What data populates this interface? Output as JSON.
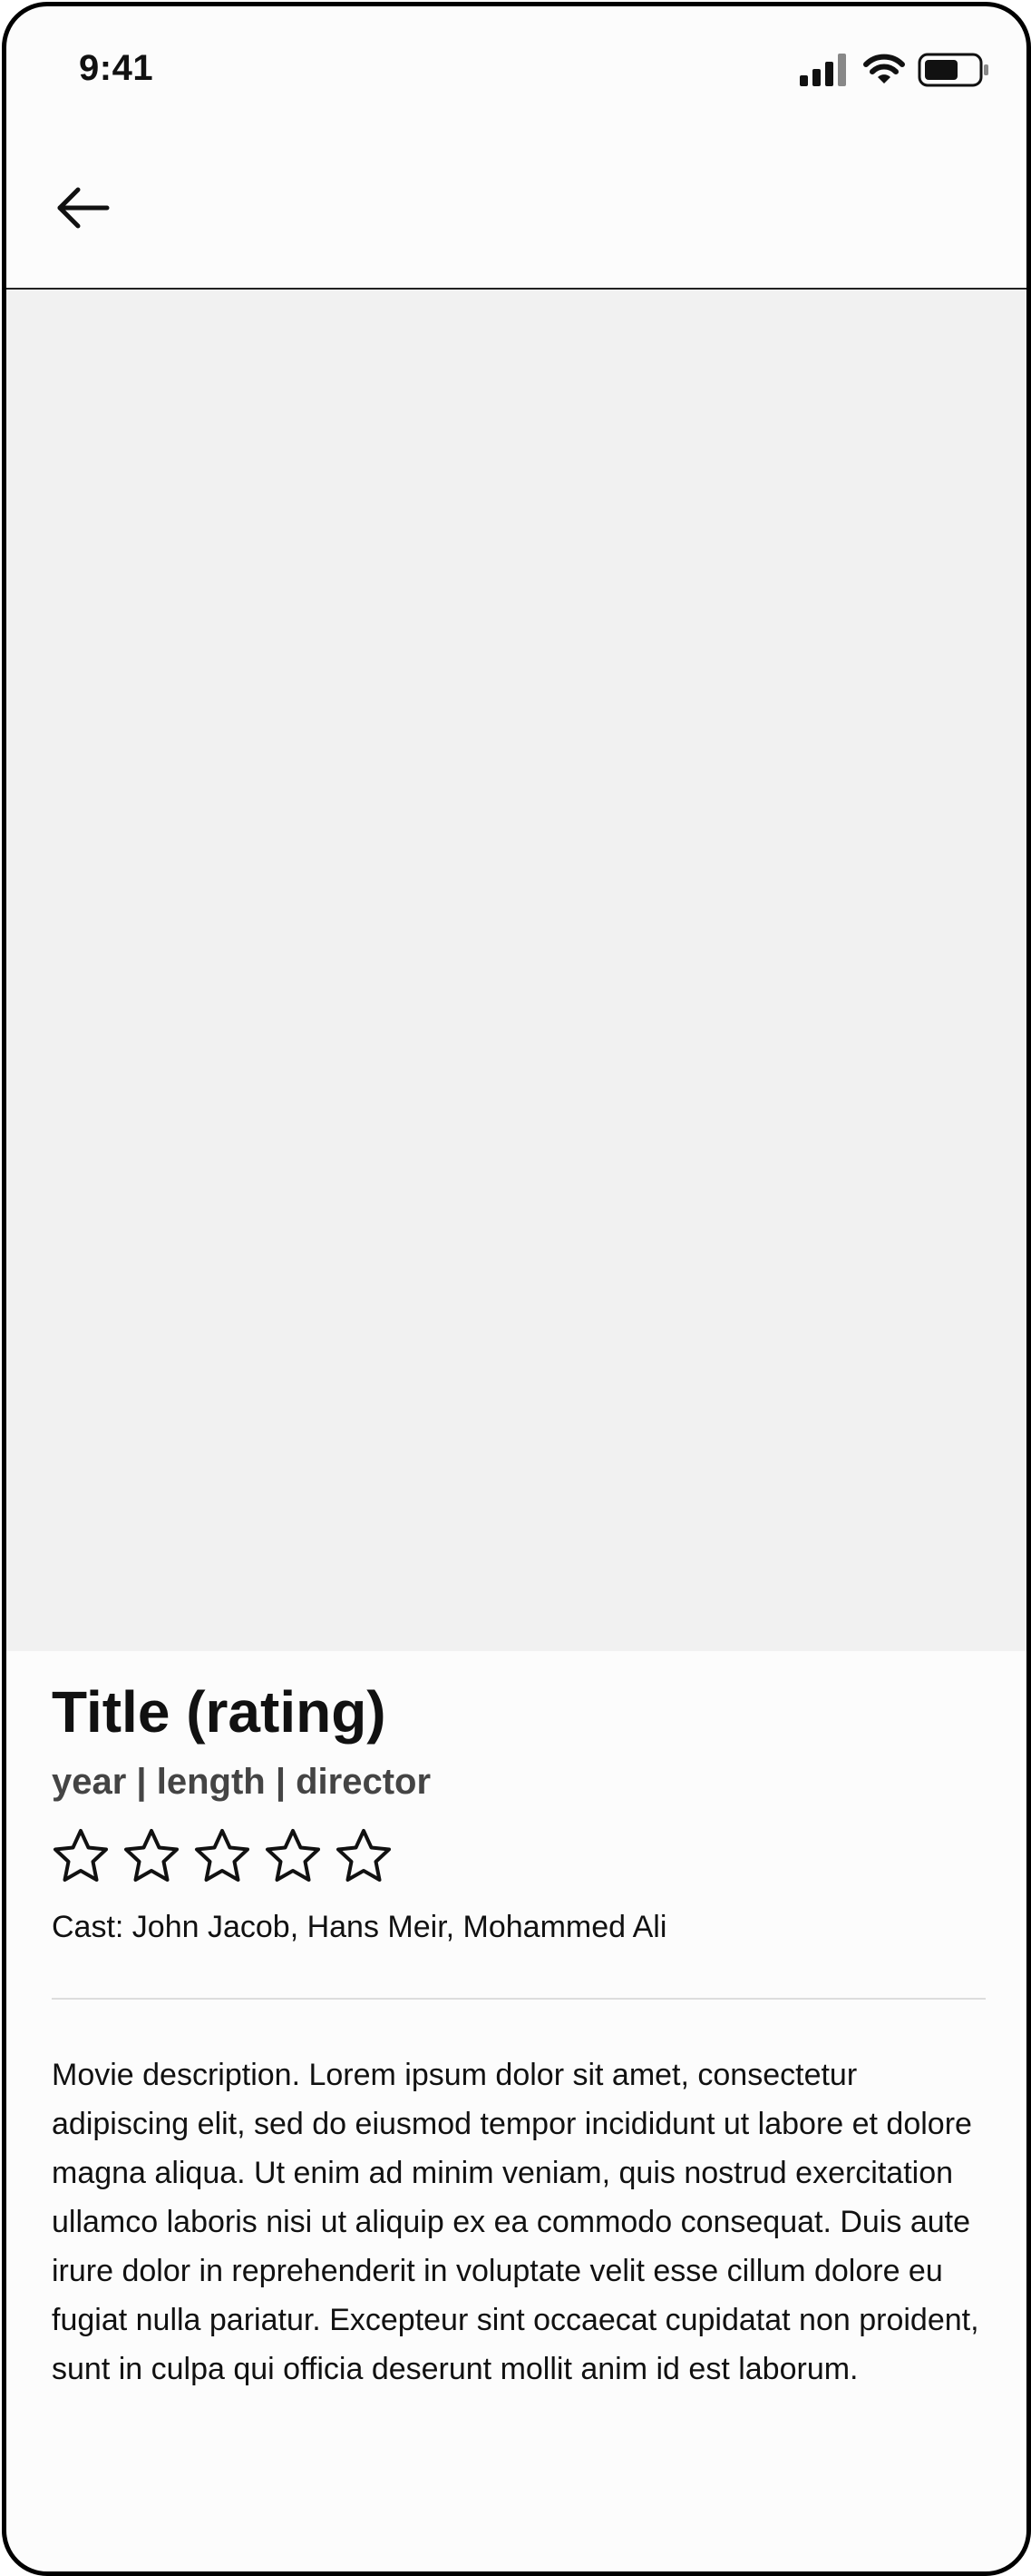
{
  "status_bar": {
    "time": "9:41"
  },
  "icons": {
    "back": "back-arrow-icon",
    "signal": "cellular-signal-icon",
    "wifi": "wifi-icon",
    "battery": "battery-icon",
    "star": "star-outline-icon"
  },
  "movie": {
    "title": "Title (rating)",
    "meta": "year | length | director",
    "rating_stars_filled": 0,
    "rating_stars_total": 5,
    "cast": "Cast: John Jacob, Hans Meir, Mohammed Ali",
    "description": "Movie description. Lorem ipsum dolor sit amet, consectetur adipiscing elit, sed do eiusmod tempor incididunt ut labore et dolore magna aliqua. Ut enim ad minim veniam, quis nostrud exercitation ullamco laboris nisi ut aliquip ex ea commodo consequat. Duis aute irure dolor in reprehenderit in voluptate velit esse cillum dolore eu fugiat nulla pariatur. Excepteur sint occaecat cupidatat non proident, sunt in culpa qui officia deserunt mollit anim id est laborum."
  },
  "colors": {
    "frame": "#000000",
    "background": "#fcfcfc",
    "hero_placeholder": "#f1f1f1",
    "meta_text": "#444444",
    "divider": "#dddddd"
  }
}
